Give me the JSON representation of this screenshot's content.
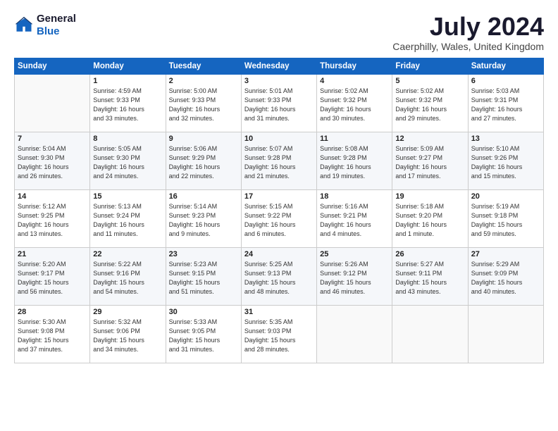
{
  "header": {
    "logo_line1": "General",
    "logo_line2": "Blue",
    "month_title": "July 2024",
    "location": "Caerphilly, Wales, United Kingdom"
  },
  "days_of_week": [
    "Sunday",
    "Monday",
    "Tuesday",
    "Wednesday",
    "Thursday",
    "Friday",
    "Saturday"
  ],
  "weeks": [
    [
      {
        "day": "",
        "info": ""
      },
      {
        "day": "1",
        "info": "Sunrise: 4:59 AM\nSunset: 9:33 PM\nDaylight: 16 hours\nand 33 minutes."
      },
      {
        "day": "2",
        "info": "Sunrise: 5:00 AM\nSunset: 9:33 PM\nDaylight: 16 hours\nand 32 minutes."
      },
      {
        "day": "3",
        "info": "Sunrise: 5:01 AM\nSunset: 9:33 PM\nDaylight: 16 hours\nand 31 minutes."
      },
      {
        "day": "4",
        "info": "Sunrise: 5:02 AM\nSunset: 9:32 PM\nDaylight: 16 hours\nand 30 minutes."
      },
      {
        "day": "5",
        "info": "Sunrise: 5:02 AM\nSunset: 9:32 PM\nDaylight: 16 hours\nand 29 minutes."
      },
      {
        "day": "6",
        "info": "Sunrise: 5:03 AM\nSunset: 9:31 PM\nDaylight: 16 hours\nand 27 minutes."
      }
    ],
    [
      {
        "day": "7",
        "info": "Sunrise: 5:04 AM\nSunset: 9:30 PM\nDaylight: 16 hours\nand 26 minutes."
      },
      {
        "day": "8",
        "info": "Sunrise: 5:05 AM\nSunset: 9:30 PM\nDaylight: 16 hours\nand 24 minutes."
      },
      {
        "day": "9",
        "info": "Sunrise: 5:06 AM\nSunset: 9:29 PM\nDaylight: 16 hours\nand 22 minutes."
      },
      {
        "day": "10",
        "info": "Sunrise: 5:07 AM\nSunset: 9:28 PM\nDaylight: 16 hours\nand 21 minutes."
      },
      {
        "day": "11",
        "info": "Sunrise: 5:08 AM\nSunset: 9:28 PM\nDaylight: 16 hours\nand 19 minutes."
      },
      {
        "day": "12",
        "info": "Sunrise: 5:09 AM\nSunset: 9:27 PM\nDaylight: 16 hours\nand 17 minutes."
      },
      {
        "day": "13",
        "info": "Sunrise: 5:10 AM\nSunset: 9:26 PM\nDaylight: 16 hours\nand 15 minutes."
      }
    ],
    [
      {
        "day": "14",
        "info": "Sunrise: 5:12 AM\nSunset: 9:25 PM\nDaylight: 16 hours\nand 13 minutes."
      },
      {
        "day": "15",
        "info": "Sunrise: 5:13 AM\nSunset: 9:24 PM\nDaylight: 16 hours\nand 11 minutes."
      },
      {
        "day": "16",
        "info": "Sunrise: 5:14 AM\nSunset: 9:23 PM\nDaylight: 16 hours\nand 9 minutes."
      },
      {
        "day": "17",
        "info": "Sunrise: 5:15 AM\nSunset: 9:22 PM\nDaylight: 16 hours\nand 6 minutes."
      },
      {
        "day": "18",
        "info": "Sunrise: 5:16 AM\nSunset: 9:21 PM\nDaylight: 16 hours\nand 4 minutes."
      },
      {
        "day": "19",
        "info": "Sunrise: 5:18 AM\nSunset: 9:20 PM\nDaylight: 16 hours\nand 1 minute."
      },
      {
        "day": "20",
        "info": "Sunrise: 5:19 AM\nSunset: 9:18 PM\nDaylight: 15 hours\nand 59 minutes."
      }
    ],
    [
      {
        "day": "21",
        "info": "Sunrise: 5:20 AM\nSunset: 9:17 PM\nDaylight: 15 hours\nand 56 minutes."
      },
      {
        "day": "22",
        "info": "Sunrise: 5:22 AM\nSunset: 9:16 PM\nDaylight: 15 hours\nand 54 minutes."
      },
      {
        "day": "23",
        "info": "Sunrise: 5:23 AM\nSunset: 9:15 PM\nDaylight: 15 hours\nand 51 minutes."
      },
      {
        "day": "24",
        "info": "Sunrise: 5:25 AM\nSunset: 9:13 PM\nDaylight: 15 hours\nand 48 minutes."
      },
      {
        "day": "25",
        "info": "Sunrise: 5:26 AM\nSunset: 9:12 PM\nDaylight: 15 hours\nand 46 minutes."
      },
      {
        "day": "26",
        "info": "Sunrise: 5:27 AM\nSunset: 9:11 PM\nDaylight: 15 hours\nand 43 minutes."
      },
      {
        "day": "27",
        "info": "Sunrise: 5:29 AM\nSunset: 9:09 PM\nDaylight: 15 hours\nand 40 minutes."
      }
    ],
    [
      {
        "day": "28",
        "info": "Sunrise: 5:30 AM\nSunset: 9:08 PM\nDaylight: 15 hours\nand 37 minutes."
      },
      {
        "day": "29",
        "info": "Sunrise: 5:32 AM\nSunset: 9:06 PM\nDaylight: 15 hours\nand 34 minutes."
      },
      {
        "day": "30",
        "info": "Sunrise: 5:33 AM\nSunset: 9:05 PM\nDaylight: 15 hours\nand 31 minutes."
      },
      {
        "day": "31",
        "info": "Sunrise: 5:35 AM\nSunset: 9:03 PM\nDaylight: 15 hours\nand 28 minutes."
      },
      {
        "day": "",
        "info": ""
      },
      {
        "day": "",
        "info": ""
      },
      {
        "day": "",
        "info": ""
      }
    ]
  ]
}
